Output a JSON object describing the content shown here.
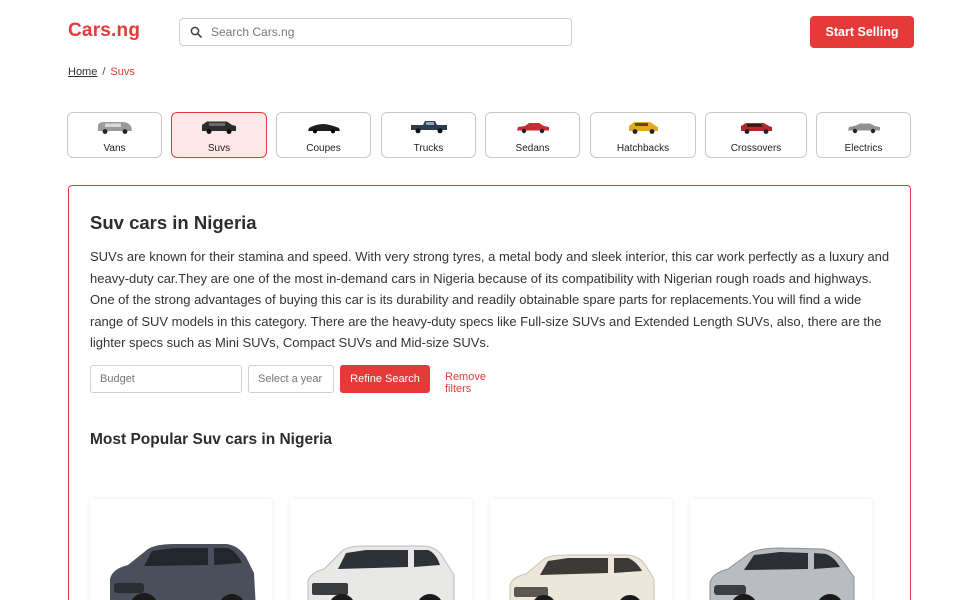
{
  "brand": {
    "logo": "Cars.ng",
    "accent": "#e53a3a"
  },
  "search": {
    "placeholder": "Search Cars.ng",
    "value": ""
  },
  "header": {
    "sell_label": "Start Selling"
  },
  "breadcrumb": {
    "home": "Home",
    "separator": "/",
    "current": "Suvs"
  },
  "categories": [
    {
      "label": "Vans",
      "icon": "van-icon",
      "active": false
    },
    {
      "label": "Suvs",
      "icon": "suv-icon",
      "active": true
    },
    {
      "label": "Coupes",
      "icon": "coupe-icon",
      "active": false
    },
    {
      "label": "Trucks",
      "icon": "truck-icon",
      "active": false
    },
    {
      "label": "Sedans",
      "icon": "sedan-icon",
      "active": false
    },
    {
      "label": "Hatchbacks",
      "icon": "hatchback-icon",
      "active": false
    },
    {
      "label": "Crossovers",
      "icon": "crossover-icon",
      "active": false
    },
    {
      "label": "Electrics",
      "icon": "electric-car-icon",
      "active": false
    }
  ],
  "main": {
    "title": "Suv cars in Nigeria",
    "description": "SUVs are known for their stamina and speed. With very strong tyres, a metal body and sleek interior, this car work perfectly as a luxury and heavy-duty car.They are one of the most in-demand cars in Nigeria because of its compatibility with Nigerian rough roads and highways. One of the strong advantages of buying this car is its durability and readily obtainable spare parts for replacements.You will find a wide range of SUV models in this category. There are the heavy-duty specs like Full-size SUVs and Extended Length SUVs, also, there are the lighter specs such as Mini SUVs, Compact SUVs and Mid-size SUVs."
  },
  "filters": {
    "budget_placeholder": "Budget",
    "year_placeholder": "Select a year",
    "refine_label": "Refine Search",
    "remove_label": "Remove filters"
  },
  "popular": {
    "title": "Most Popular Suv cars in Nigeria",
    "cards": [
      {
        "icon": "compact-suv-photo",
        "color": "#4a4f5c"
      },
      {
        "icon": "luxury-suv-photo",
        "color": "#e8e8e6"
      },
      {
        "icon": "fullsize-suv-photo",
        "color": "#ece7da"
      },
      {
        "icon": "crossover-suv-photo",
        "color": "#b9bcc0"
      }
    ]
  }
}
